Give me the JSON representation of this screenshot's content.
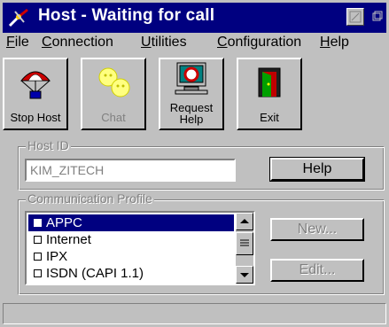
{
  "window": {
    "title": "Host - Waiting for call",
    "title_icon": "satellite-dish-icon"
  },
  "menu": [
    {
      "label": "File",
      "access": "F"
    },
    {
      "label": "Connection",
      "access": "C"
    },
    {
      "label": "Utilities",
      "access": "U"
    },
    {
      "label": "Configuration",
      "access": "C"
    },
    {
      "label": "Help",
      "access": "H"
    }
  ],
  "toolbar": {
    "stop_host": {
      "label": "Stop Host",
      "icon": "parachute-icon"
    },
    "chat": {
      "label": "Chat",
      "icon": "chat-faces-icon"
    },
    "request_help": {
      "label1": "Request",
      "label2": "Help",
      "icon": "monitor-lifebuoy-icon"
    },
    "exit": {
      "label": "Exit",
      "icon": "exit-door-icon"
    }
  },
  "host_id": {
    "group_label": "Host ID",
    "value": "KIM_ZITECH",
    "help_button": "Help"
  },
  "comm_profile": {
    "group_label": "Communication Profile",
    "items": [
      {
        "label": "APPC",
        "selected": true
      },
      {
        "label": "Internet",
        "selected": false
      },
      {
        "label": "IPX",
        "selected": false
      },
      {
        "label": "ISDN (CAPI 1.1)",
        "selected": false
      }
    ],
    "new_button": "New...",
    "edit_button": "Edit..."
  },
  "status_bar": {
    "text": ""
  },
  "colors": {
    "title_bar": "#000080",
    "face": "#c0c0c0",
    "selection": "#000080"
  }
}
